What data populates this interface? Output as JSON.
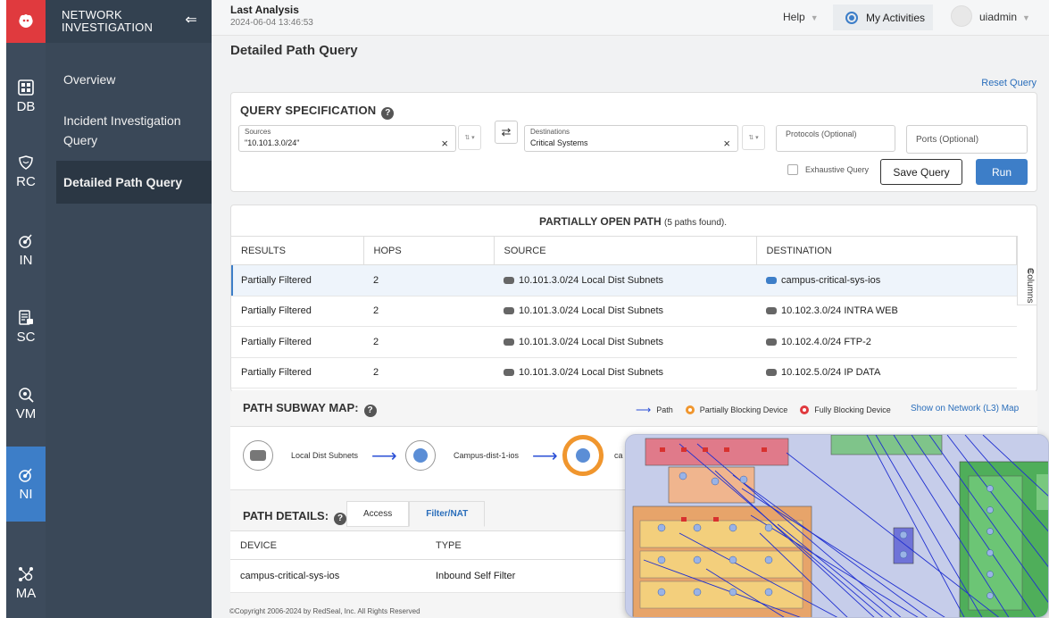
{
  "rail": {
    "items": [
      {
        "label": "DB",
        "icon": "dashboard-icon"
      },
      {
        "label": "RC",
        "icon": "shield-icon"
      },
      {
        "label": "IN",
        "icon": "radar-icon"
      },
      {
        "label": "SC",
        "icon": "report-lock-icon"
      },
      {
        "label": "VM",
        "icon": "zoom-target-icon"
      },
      {
        "label": "NI",
        "icon": "network-radar-icon"
      },
      {
        "label": "MA",
        "icon": "topology-gear-icon"
      }
    ],
    "active": "NI"
  },
  "nav": {
    "title_line1": "NETWORK",
    "title_line2": "INVESTIGATION",
    "items": [
      "Overview",
      "Incident Investigation Query",
      "Detailed Path Query"
    ],
    "active": "Detailed Path Query"
  },
  "header": {
    "last_analysis_label": "Last Analysis",
    "last_analysis_date": "2024-06-04 13:46:53",
    "help": "Help",
    "my_activities": "My Activities",
    "user": "uiadmin"
  },
  "page": {
    "title": "Detailed Path Query",
    "reset": "Reset Query"
  },
  "query": {
    "title": "QUERY SPECIFICATION",
    "sources_label": "Sources",
    "sources_value": "\"10.101.3.0/24\"",
    "destinations_label": "Destinations",
    "destinations_value": "Critical Systems",
    "protocols_placeholder": "Protocols (Optional)",
    "ports_placeholder": "Ports (Optional)",
    "exhaustive": "Exhaustive Query",
    "save": "Save Query",
    "run": "Run"
  },
  "results": {
    "title": "PARTIALLY OPEN PATH",
    "subtitle": "(5 paths found).",
    "columns": [
      "RESULTS",
      "HOPS",
      "SOURCE",
      "DESTINATION"
    ],
    "columns_button": "Columns",
    "rows": [
      {
        "result": "Partially Filtered",
        "hops": "2",
        "source": "10.101.3.0/24 Local Dist Subnets",
        "destination": "campus-critical-sys-ios"
      },
      {
        "result": "Partially Filtered",
        "hops": "2",
        "source": "10.101.3.0/24 Local Dist Subnets",
        "destination": "10.102.3.0/24 INTRA WEB"
      },
      {
        "result": "Partially Filtered",
        "hops": "2",
        "source": "10.101.3.0/24 Local Dist Subnets",
        "destination": "10.102.4.0/24 FTP-2"
      },
      {
        "result": "Partially Filtered",
        "hops": "2",
        "source": "10.101.3.0/24 Local Dist Subnets",
        "destination": "10.102.5.0/24 IP DATA"
      }
    ]
  },
  "subway": {
    "title": "PATH SUBWAY MAP:",
    "legend_path": "Path",
    "legend_partial": "Partially Blocking Device",
    "legend_full": "Fully Blocking Device",
    "show_network": "Show on Network (L3) Map",
    "nodes": [
      "Local Dist Subnets",
      "Campus-dist-1-ios",
      "ca"
    ],
    "colors": {
      "path": "#2a4fd6",
      "partial": "#f0962e",
      "full": "#e0393e"
    }
  },
  "details": {
    "title": "PATH DETAILS:",
    "tabs": [
      "Access",
      "Filter/NAT"
    ],
    "active_tab": "Filter/NAT",
    "columns": [
      "DEVICE",
      "TYPE"
    ],
    "rows": [
      {
        "device": "campus-critical-sys-ios",
        "type": "Inbound Self Filter"
      }
    ]
  },
  "footer": "©Copyright 2006-2024 by RedSeal, Inc. All Rights Reserved",
  "theme": {
    "accent": "#3d7ec8",
    "brand": "#e03a3e",
    "rail": "#3d4b5c",
    "nav": "#3a4858"
  }
}
